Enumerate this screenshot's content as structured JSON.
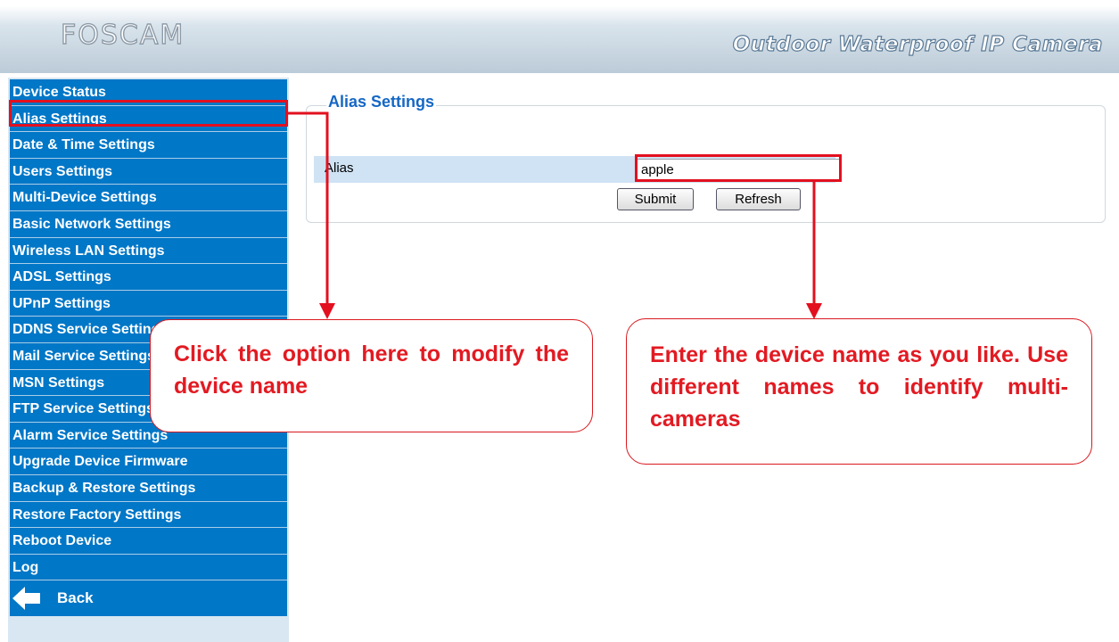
{
  "header": {
    "logo": "FOSCAM",
    "tagline": "Outdoor Waterproof IP Camera"
  },
  "sidebar": {
    "items": [
      {
        "label": "Device Status"
      },
      {
        "label": "Alias Settings"
      },
      {
        "label": "Date & Time Settings"
      },
      {
        "label": "Users Settings"
      },
      {
        "label": "Multi-Device Settings"
      },
      {
        "label": "Basic Network Settings"
      },
      {
        "label": "Wireless LAN Settings"
      },
      {
        "label": "ADSL Settings"
      },
      {
        "label": "UPnP Settings"
      },
      {
        "label": "DDNS Service Settings"
      },
      {
        "label": "Mail Service Settings"
      },
      {
        "label": "MSN Settings"
      },
      {
        "label": "FTP Service Settings"
      },
      {
        "label": "Alarm Service Settings"
      },
      {
        "label": "Upgrade Device Firmware"
      },
      {
        "label": "Backup & Restore Settings"
      },
      {
        "label": "Restore Factory Settings"
      },
      {
        "label": "Reboot Device"
      },
      {
        "label": "Log"
      }
    ],
    "back_label": "Back",
    "back_icon": "back-arrow-icon"
  },
  "main": {
    "section_title": "Alias Settings",
    "alias_label": "Alias",
    "alias_value": "apple",
    "submit_label": "Submit",
    "refresh_label": "Refresh"
  },
  "annotations": {
    "callout_left": "Click the option here to modify the device name",
    "callout_right": "Enter the device name as you like. Use different names to identify multi-cameras",
    "highlight_color": "#e3101f"
  },
  "colors": {
    "menu_bg": "#0077c7",
    "menu_text": "#ffffff",
    "title_blue": "#1567c5",
    "callout_text": "#e21a22",
    "alias_row_bg": "#cfe3f5"
  }
}
